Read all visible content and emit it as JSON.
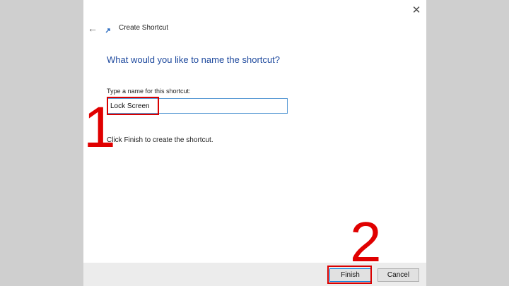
{
  "window": {
    "title": "Create Shortcut",
    "close_icon": "close-icon",
    "back_icon": "back-arrow-icon",
    "title_icon": "shortcut-icon"
  },
  "content": {
    "heading": "What would you like to name the shortcut?",
    "field_label": "Type a name for this shortcut:",
    "field_value": "Lock Screen",
    "instruction": "Click Finish to create the shortcut."
  },
  "footer": {
    "finish_label": "Finish",
    "cancel_label": "Cancel"
  },
  "annotations": {
    "step1": "1",
    "step2": "2",
    "highlight_color": "#d90000"
  }
}
